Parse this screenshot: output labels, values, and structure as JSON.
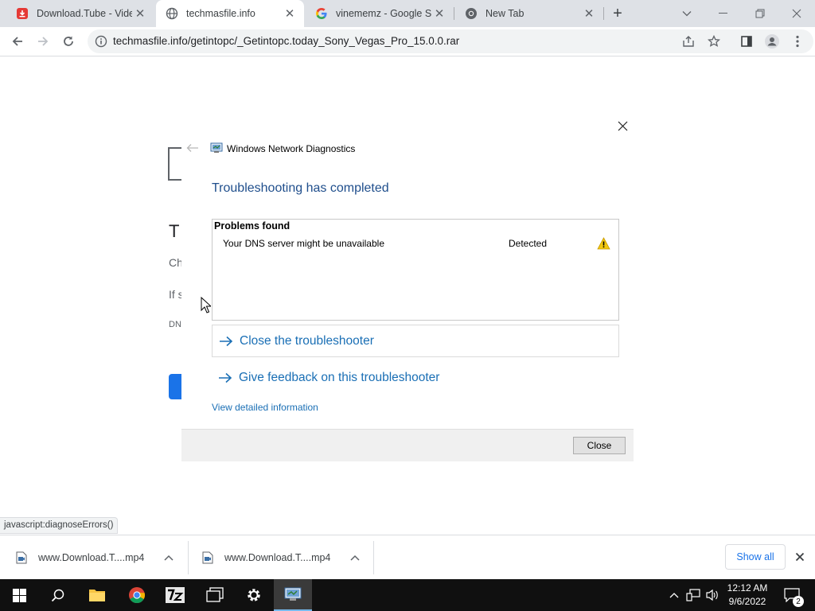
{
  "browser": {
    "tabs": [
      {
        "title": "Download.Tube - Video",
        "favicon": "download-tube-icon",
        "active": false
      },
      {
        "title": "techmasfile.info",
        "favicon": "globe-icon",
        "active": true
      },
      {
        "title": "vinememz - Google Sea",
        "favicon": "google-icon",
        "active": false
      },
      {
        "title": "New Tab",
        "favicon": "chrome-icon",
        "active": false
      }
    ],
    "address_bar": {
      "url": "techmasfile.info/getintopc/_Getintopc.today_Sony_Vegas_Pro_15.0.0.rar"
    }
  },
  "page_behind": {
    "heading_initial": "T",
    "line1": "Ch",
    "line2": "If s",
    "line3": "DN"
  },
  "dialog": {
    "window_title": "Windows Network Diagnostics",
    "heading": "Troubleshooting has completed",
    "problems_header": "Problems found",
    "problems": [
      {
        "description": "Your DNS server might be unavailable",
        "status": "Detected",
        "icon": "warning-icon"
      }
    ],
    "options": [
      {
        "label": "Close the troubleshooter"
      },
      {
        "label": "Give feedback on this troubleshooter"
      }
    ],
    "details_link": "View detailed information",
    "close_button": "Close"
  },
  "status_bar": {
    "text": "javascript:diagnoseErrors()"
  },
  "downloads": {
    "items": [
      {
        "name": "www.Download.T....mp4"
      },
      {
        "name": "www.Download.T....mp4"
      }
    ],
    "show_all": "Show all"
  },
  "taskbar": {
    "time": "12:12 AM",
    "date": "9/6/2022",
    "notification_count": "2"
  },
  "colors": {
    "link_blue": "#1a6fb5",
    "heading_blue": "#1f4e8c",
    "taskbar_bg": "#101010",
    "tabstrip_bg": "#dee1e6"
  }
}
